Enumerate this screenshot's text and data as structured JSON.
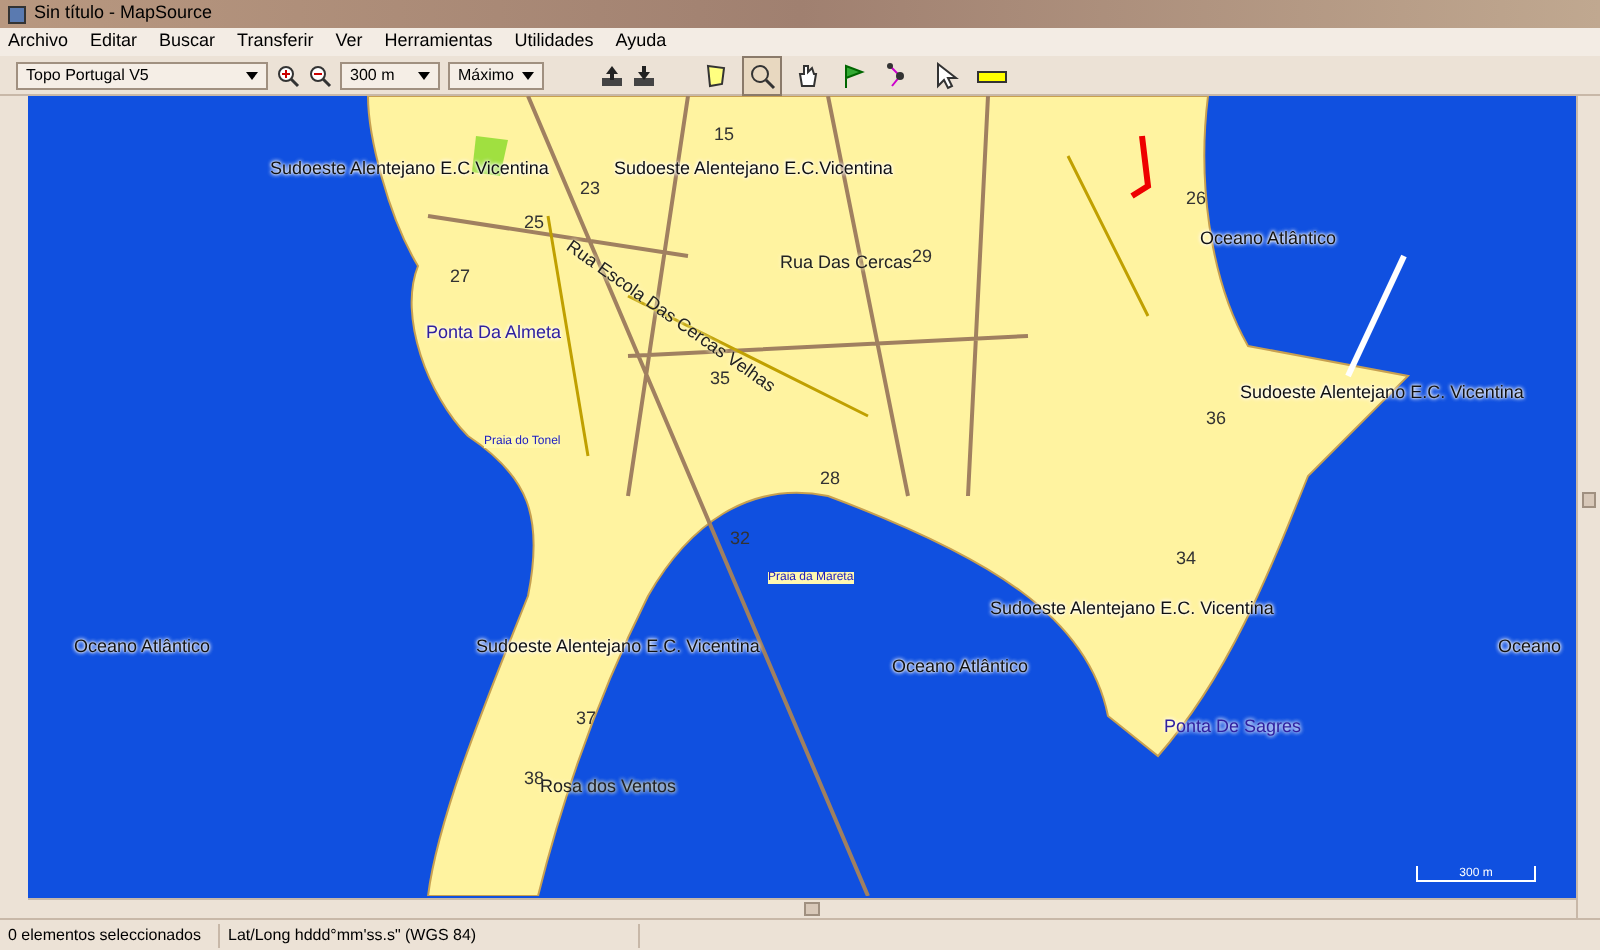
{
  "window": {
    "title": "Sin título - MapSource"
  },
  "menu": [
    "Archivo",
    "Editar",
    "Buscar",
    "Transferir",
    "Ver",
    "Herramientas",
    "Utilidades",
    "Ayuda"
  ],
  "toolbar": {
    "map_product": "Topo Portugal V5",
    "zoom_scale": "300 m",
    "detail": "Máximo",
    "tools": [
      {
        "kind": "area",
        "selected": false
      },
      {
        "kind": "zoom",
        "selected": true
      },
      {
        "kind": "hand",
        "selected": false
      },
      {
        "kind": "flag",
        "selected": false
      },
      {
        "kind": "route",
        "selected": false
      },
      {
        "kind": "pointer",
        "selected": false
      },
      {
        "kind": "ruler",
        "selected": false
      }
    ]
  },
  "map": {
    "labels": [
      {
        "text": "Sudoeste Alentejano E.C.Vicentina",
        "kind": "area"
      },
      {
        "text": "Sudoeste Alentejano E.C.Vicentina",
        "kind": "area"
      },
      {
        "text": "Rua Das Cercas",
        "kind": "street"
      },
      {
        "text": "Ponta Da Almeta",
        "kind": "place"
      },
      {
        "text": "Rua Escola Das Cercas Velhas",
        "kind": "street"
      },
      {
        "text": "Oceano Atlântico",
        "kind": "area"
      },
      {
        "text": "Sudoeste Alentejano E.C. Vicentina",
        "kind": "area"
      },
      {
        "text": "Sudoeste Alentejano E.C. Vicentina",
        "kind": "area"
      },
      {
        "text": "Oceano Atlântico",
        "kind": "area"
      },
      {
        "text": "Sudoeste Alentejano E.C. Vicentina",
        "kind": "area"
      },
      {
        "text": "Oceano",
        "kind": "area"
      },
      {
        "text": "Oceano Atlântico",
        "kind": "area"
      },
      {
        "text": "Ponta De Sagres",
        "kind": "place"
      },
      {
        "text": "Rosa dos Ventos",
        "kind": "street"
      },
      {
        "text": "Praia do Tonel",
        "kind": "poi"
      },
      {
        "text": "Praia da Mareta",
        "kind": "poi"
      },
      {
        "text": "27",
        "kind": "number"
      },
      {
        "text": "25",
        "kind": "number"
      },
      {
        "text": "23",
        "kind": "number"
      },
      {
        "text": "15",
        "kind": "number"
      },
      {
        "text": "29",
        "kind": "number"
      },
      {
        "text": "35",
        "kind": "number"
      },
      {
        "text": "34",
        "kind": "number"
      },
      {
        "text": "36",
        "kind": "number"
      },
      {
        "text": "26",
        "kind": "number"
      },
      {
        "text": "32",
        "kind": "number"
      },
      {
        "text": "28",
        "kind": "number"
      },
      {
        "text": "38",
        "kind": "number"
      },
      {
        "text": "37",
        "kind": "number"
      }
    ],
    "scale": "300 m"
  },
  "status_bar": [
    "0 elementos seleccionados",
    "Lat/Long hddd°mm'ss.s\" (WGS 84)"
  ]
}
